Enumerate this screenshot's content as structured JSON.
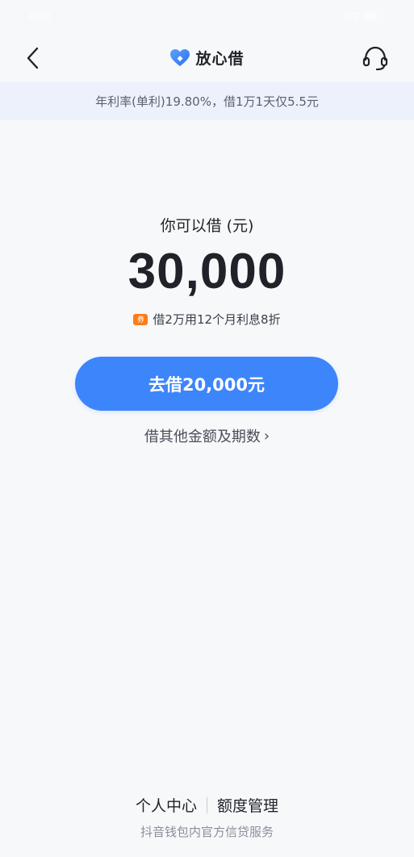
{
  "status_bar": {
    "time": "8:36",
    "network": "5G"
  },
  "nav": {
    "title": "放心借",
    "icons": {
      "back": "back-chevron-icon",
      "brand": "heart-logo-icon",
      "support": "headset-icon"
    }
  },
  "banner": {
    "rate_text": "年利率(单利)19.80%，借1万1天仅5.5元"
  },
  "loan": {
    "label": "你可以借 (元)",
    "amount": "30,000",
    "promo_text": "借2万用12个月利息8折",
    "coupon_icon_text": "券",
    "borrow_button": "去借20,000元",
    "other_link": "借其他金额及期数",
    "other_link_arrow": "›"
  },
  "footer": {
    "personal_center": "个人中心",
    "quota_management": "额度管理",
    "note": "抖音钱包内官方信贷服务"
  },
  "colors": {
    "primary": "#3d85fb",
    "banner_bg": "#edf1fb",
    "page_bg": "#f7f8fa",
    "coupon": "#ff7a1a"
  }
}
